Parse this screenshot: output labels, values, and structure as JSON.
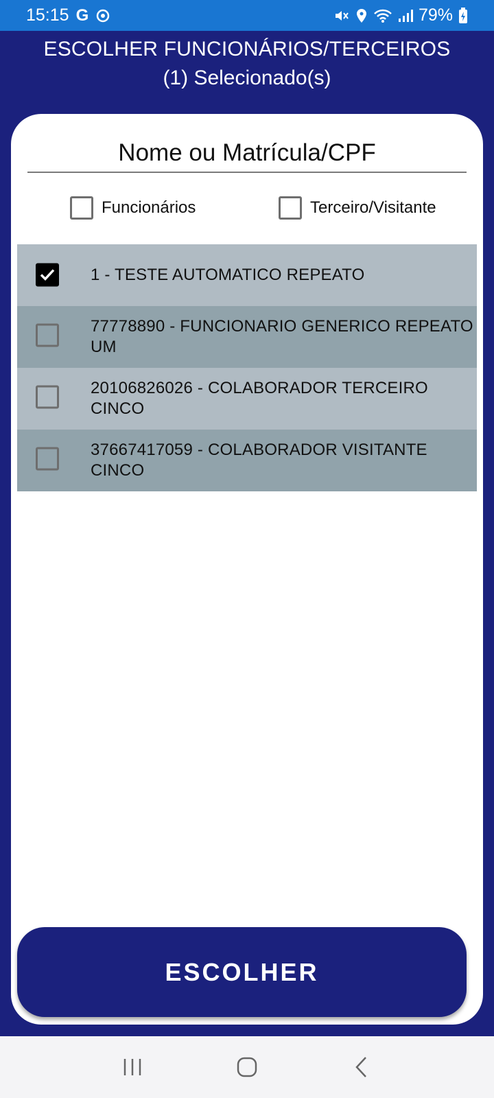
{
  "status_bar": {
    "time": "15:15",
    "battery": "79%",
    "icons": [
      "google-icon",
      "sync-icon",
      "mute-icon",
      "location-icon",
      "wifi-icon",
      "signal-icon",
      "battery-icon"
    ]
  },
  "header": {
    "title": "ESCOLHER FUNCIONÁRIOS/TERCEIROS",
    "selected_count": "(1) Selecionado(s)"
  },
  "search": {
    "placeholder": "Nome ou Matrícula/CPF",
    "value": ""
  },
  "filters": [
    {
      "label": "Funcionários",
      "checked": false
    },
    {
      "label": "Terceiro/Visitante",
      "checked": false
    }
  ],
  "people": [
    {
      "line1": "1 - TESTE AUTOMATICO REPEATO",
      "line2": "",
      "checked": true
    },
    {
      "line1": "77778890 - FUNCIONARIO GENERICO REPEATO",
      "line2": "UM",
      "checked": false
    },
    {
      "line1": "20106826026 - COLABORADOR TERCEIRO",
      "line2": "CINCO",
      "checked": false
    },
    {
      "line1": "37667417059 - COLABORADOR VISITANTE",
      "line2": "CINCO",
      "checked": false
    }
  ],
  "actions": {
    "choose_label": "ESCOLHER"
  },
  "nav": [
    "recent-apps-icon",
    "home-icon",
    "back-icon"
  ],
  "colors": {
    "primary": "#1b217d",
    "status_bar": "#1976d2",
    "row_light": "#b0bbc3",
    "row_dark": "#91a3ab"
  }
}
